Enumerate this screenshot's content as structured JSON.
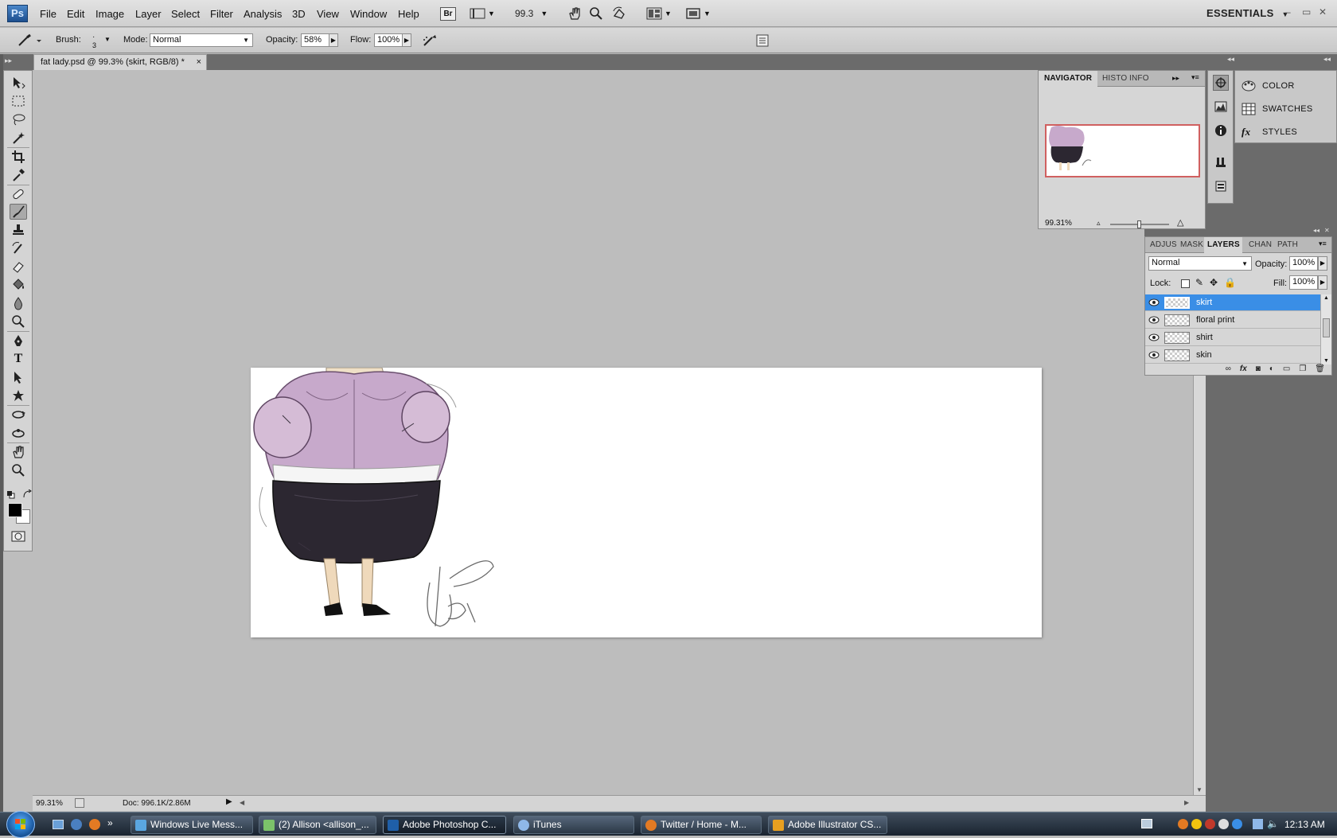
{
  "menubar": {
    "items": [
      "File",
      "Edit",
      "Image",
      "Layer",
      "Select",
      "Filter",
      "Analysis",
      "3D",
      "View",
      "Window",
      "Help"
    ],
    "bridge_label": "Br",
    "zoom_value": "99.3",
    "workspace": "ESSENTIALS"
  },
  "options": {
    "brush_label": "Brush:",
    "brush_size": "3",
    "mode_label": "Mode:",
    "mode_value": "Normal",
    "opacity_label": "Opacity:",
    "opacity_value": "58%",
    "flow_label": "Flow:",
    "flow_value": "100%"
  },
  "document": {
    "tab_title": "fat lady.psd @ 99.3% (skirt, RGB/8) *",
    "close": "×"
  },
  "status": {
    "zoom": "99.31%",
    "doc": "Doc: 996.1K/2.86M"
  },
  "navigator": {
    "tabs": [
      "NAVIGATOR",
      "HISTO",
      "INFO"
    ],
    "zoom": "99.31%"
  },
  "side_panels": [
    "COLOR",
    "SWATCHES",
    "STYLES"
  ],
  "layers_panel": {
    "tabs": [
      "ADJUS",
      "MASK",
      "LAYERS",
      "CHAN",
      "PATH"
    ],
    "blend_mode": "Normal",
    "opacity_label": "Opacity:",
    "opacity_value": "100%",
    "lock_label": "Lock:",
    "fill_label": "Fill:",
    "fill_value": "100%",
    "layers": [
      {
        "name": "skirt",
        "selected": true
      },
      {
        "name": "floral print",
        "selected": false
      },
      {
        "name": "shirt",
        "selected": false
      },
      {
        "name": "skin",
        "selected": false
      }
    ]
  },
  "taskbar": {
    "items": [
      {
        "label": "Windows Live Mess...",
        "color": "#5aa6e0"
      },
      {
        "label": "(2) Allison <allison_...",
        "color": "#7cc26a"
      },
      {
        "label": "Adobe Photoshop C...",
        "color": "#1f5fa8"
      },
      {
        "label": "iTunes",
        "color": "#8fb8e8"
      },
      {
        "label": "Twitter / Home - M...",
        "color": "#e37a23"
      },
      {
        "label": "Adobe Illustrator CS...",
        "color": "#e8a020"
      }
    ],
    "time": "12:13 AM"
  },
  "colors": {
    "accent": "#3a8ee6",
    "workspace": "#bdbdbd",
    "panel": "#d6d6d6"
  }
}
